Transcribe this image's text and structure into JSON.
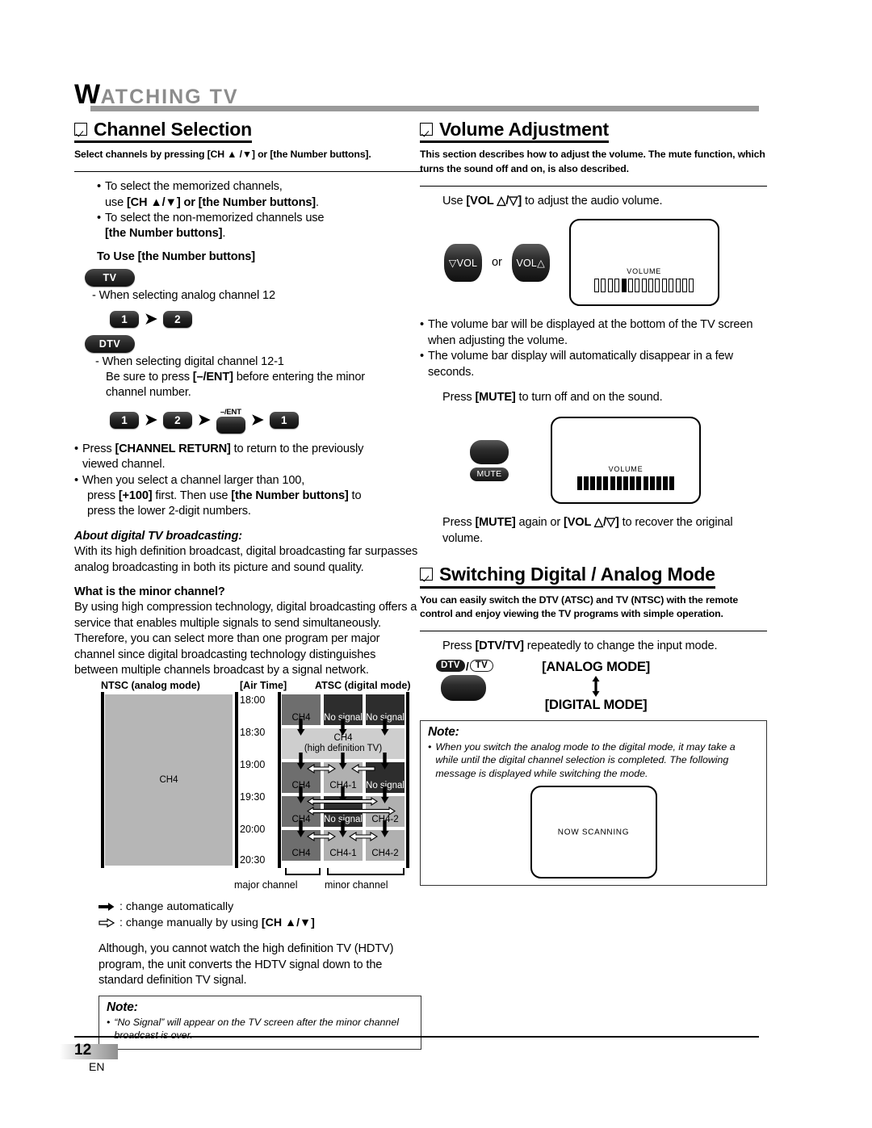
{
  "chapter": {
    "cap": "W",
    "rest": "ATCHING  TV"
  },
  "left": {
    "section": {
      "title": "Channel Selection",
      "subtitle": "Select channels by pressing [CH ▲ /▼] or [the Number buttons]."
    },
    "bullets": [
      {
        "lead": "To select the memorized channels,",
        "cont_plain": "use ",
        "cont_bold": "[CH ▲/▼] or [the Number buttons]",
        "cont_tail": "."
      },
      {
        "lead": "To select the non-memorized channels use",
        "cont_bold": "[the Number buttons]",
        "cont_tail": "."
      }
    ],
    "number_buttons_heading": "To Use [the Number buttons]",
    "tv_tag": "TV",
    "tv_line": "- When selecting analog channel 12",
    "tv_sequence": [
      "1",
      "2"
    ],
    "dtv_tag": "DTV",
    "dtv_line1": "- When selecting digital channel 12-1",
    "dtv_line2_a": "Be sure to press ",
    "dtv_line2_b": "[–/ENT]",
    "dtv_line2_c": " before entering the minor",
    "dtv_line3": "channel number.",
    "dtv_sequence": [
      "1",
      "2",
      "",
      "1"
    ],
    "ent_label": "–/ENT",
    "bullets2": [
      {
        "a": "Press ",
        "b": "[CHANNEL RETURN]",
        "c": " to return to the previously",
        "d": "viewed channel."
      },
      {
        "a": "When you select a channel larger than 100,",
        "b": "",
        "c": "",
        "d": ""
      }
    ],
    "plus100_line_a": "press ",
    "plus100_line_b": "[+100]",
    "plus100_line_c": " first. Then use ",
    "plus100_line_d": "[the Number buttons]",
    "plus100_line_e": " to",
    "plus100_line_f": "press the lower 2-digit numbers.",
    "about_heading": "About digital TV broadcasting:",
    "about_body": "With its high definition broadcast, digital broadcasting far surpasses analog broadcasting in both its picture and sound quality.",
    "minor_heading": "What is the minor channel?",
    "minor_body_1": "By using high compression technology, digital broadcasting offers a service that enables multiple signals to send simultaneously.",
    "minor_body_2": "Therefore, you can select more than one program per major channel since digital broadcasting technology distinguishes between multiple channels broadcast by a signal network.",
    "legend": {
      "auto": ": change automatically",
      "manual_a": ": change manually by using ",
      "manual_b": "[CH ▲/▼]"
    },
    "hdtv_body": "Although, you cannot watch the high definition TV (HDTV) program, the unit converts the HDTV signal down to the standard definition TV signal.",
    "note": {
      "heading": "Note:",
      "bullet": "“No Signal” will appear on the TV screen after the minor channel broadcast is over."
    }
  },
  "diagram": {
    "header_ntsc": "NTSC (analog mode)",
    "header_airtime": "[Air Time]",
    "header_atsc": "ATSC (digital mode)",
    "ntsc_cell": "CH4",
    "times": [
      "18:00",
      "18:30",
      "19:00",
      "19:30",
      "20:00",
      "20:30"
    ],
    "rows": [
      {
        "cells": [
          {
            "text": "CH4",
            "tone": "mid"
          },
          {
            "text": "No signal",
            "tone": "dark"
          },
          {
            "text": "No signal",
            "tone": "dark"
          }
        ]
      },
      {
        "span": true,
        "text_1": "CH4",
        "text_2": "(high definition TV)",
        "tone": "pale"
      },
      {
        "cells": [
          {
            "text": "CH4",
            "tone": "mid"
          },
          {
            "text": "CH4-1",
            "tone": "lite"
          },
          {
            "text": "No signal",
            "tone": "dark"
          }
        ]
      },
      {
        "cells": [
          {
            "text": "CH4",
            "tone": "mid"
          },
          {
            "text": "No signal",
            "tone": "dark"
          },
          {
            "text": "CH4-2",
            "tone": "lite"
          }
        ]
      },
      {
        "cells": [
          {
            "text": "CH4",
            "tone": "mid"
          },
          {
            "text": "CH4-1",
            "tone": "lite"
          },
          {
            "text": "CH4-2",
            "tone": "lite"
          }
        ]
      }
    ],
    "bracket_major": "major channel",
    "bracket_minor": "minor channel"
  },
  "right": {
    "volume": {
      "title": "Volume Adjustment",
      "subtitle": "This section describes how to adjust the volume. The mute function, which turns the sound off and on, is also described.",
      "use_line_a": "Use ",
      "use_line_b": "[VOL △/▽]",
      "use_line_c": " to adjust the audio volume.",
      "btn_down": "▽VOL",
      "btn_or": "or",
      "btn_up": "VOL△",
      "osd_title": "VOLUME",
      "bars_before": 4,
      "bars_filled": 1,
      "bars_after": 10,
      "bullets": [
        "The volume bar will be displayed at the bottom of the TV screen when adjusting the volume.",
        "The volume bar display will automatically disappear in a few seconds."
      ],
      "mute_line_a": "Press ",
      "mute_line_b": "[MUTE]",
      "mute_line_c": " to turn off and on the sound.",
      "mute_label": "MUTE",
      "mute_osd_title": "VOLUME",
      "mute_bars_filled": 15,
      "recover_a": "Press ",
      "recover_b": "[MUTE]",
      "recover_c": " again or ",
      "recover_d": "[VOL △/▽]",
      "recover_e": " to recover the original",
      "recover_f": "volume."
    },
    "switching": {
      "title": "Switching Digital / Analog Mode",
      "subtitle": "You can easily switch the DTV (ATSC) and TV (NTSC) with the remote control and enjoy viewing the TV programs with simple operation.",
      "press_a": "Press ",
      "press_b": "[DTV/TV]",
      "press_c": " repeatedly to change the input mode.",
      "tag_dtv": "DTV",
      "tag_slash": "/",
      "tag_tv": "TV",
      "mode_analog": "[ANALOG MODE]",
      "mode_digital": "[DIGITAL MODE]",
      "note": {
        "heading": "Note:",
        "bullet": "When you switch the analog mode to the digital mode, it may take a while until the digital channel selection is completed. The following message is displayed while switching the mode.",
        "screen_text": "NOW SCANNING"
      }
    }
  },
  "footer": {
    "page": "12",
    "lang": "EN"
  }
}
